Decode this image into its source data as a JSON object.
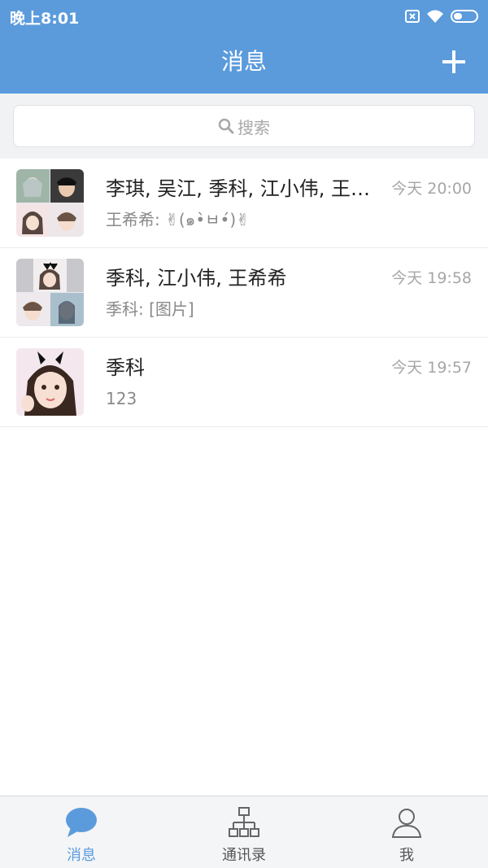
{
  "status_bar": {
    "time": "晚上8:01",
    "icons": [
      "sim-x-icon",
      "wifi-icon",
      "battery-icon"
    ]
  },
  "header": {
    "title": "消息",
    "add_icon": "plus-icon"
  },
  "search": {
    "placeholder": "搜索",
    "icon": "search-icon"
  },
  "conversations": [
    {
      "name": "李琪, 吴江, 季科, 江小伟, 王…",
      "time": "今天 20:00",
      "last_message": "王希希: ✌(๑•̀ㅂ•́)✌",
      "avatar": "group-avatar-four"
    },
    {
      "name": "季科, 江小伟, 王希希",
      "time": "今天 19:58",
      "last_message": "季科: [图片]",
      "avatar": "group-avatar-three"
    },
    {
      "name": "季科",
      "time": "今天 19:57",
      "last_message": "123",
      "avatar": "user-avatar"
    }
  ],
  "tabbar": {
    "tabs": [
      {
        "label": "消息",
        "icon": "chat-bubble-icon",
        "active": true
      },
      {
        "label": "通讯录",
        "icon": "org-chart-icon",
        "active": false
      },
      {
        "label": "我",
        "icon": "person-icon",
        "active": false
      }
    ]
  },
  "colors": {
    "primary": "#5b9bdc",
    "background": "#f1f2f4",
    "text_primary": "#222222",
    "text_secondary": "#8a8a8a"
  }
}
